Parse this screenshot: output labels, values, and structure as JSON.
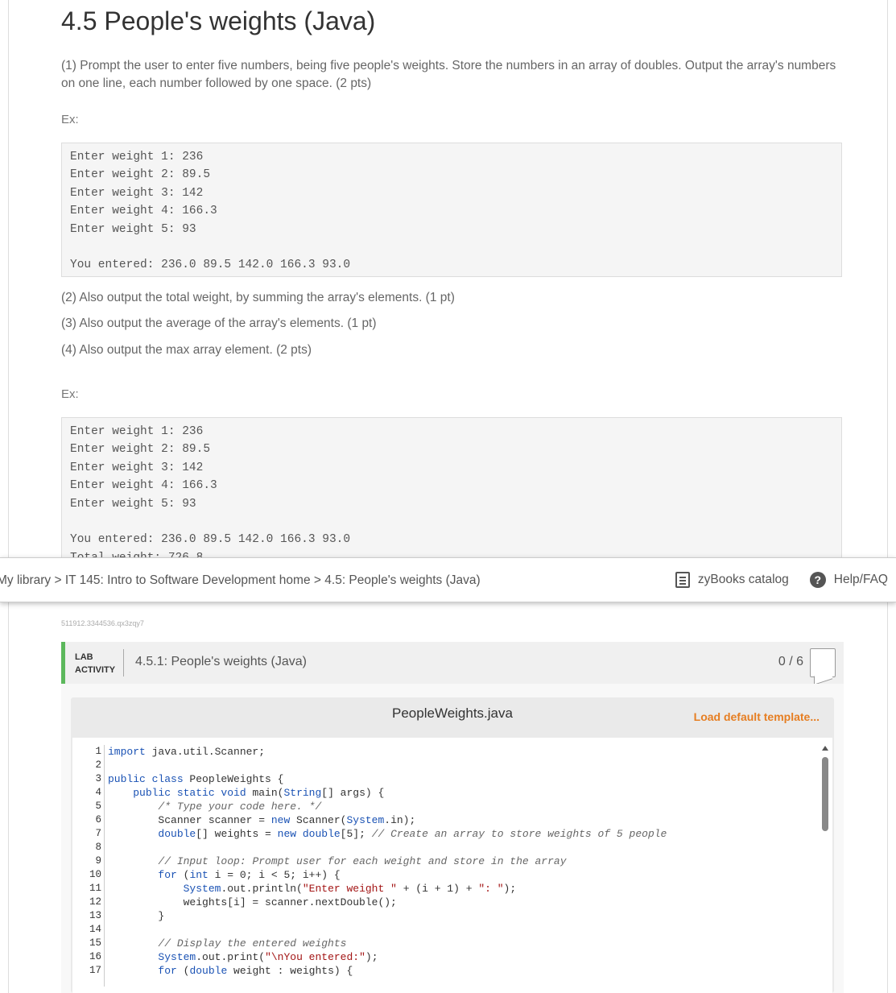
{
  "problem": {
    "title": "4.5 People's weights (Java)",
    "part1": "(1) Prompt the user to enter five numbers, being five people's weights. Store the numbers in an array of doubles. Output the array's numbers on one line, each number followed by one space. (2 pts)",
    "ex_label": "Ex:",
    "example1": {
      "lines": [
        "Enter weight 1: 236",
        "Enter weight 2: 89.5",
        "Enter weight 3: 142",
        "Enter weight 4: 166.3",
        "Enter weight 5: 93"
      ],
      "result": "You entered: 236.0 89.5 142.0 166.3 93.0"
    },
    "part2": "(2) Also output the total weight, by summing the array's elements. (1 pt)",
    "part3": "(3) Also output the average of the array's elements. (1 pt)",
    "part4": "(4) Also output the max array element. (2 pts)",
    "example2": {
      "lines": [
        "Enter weight 1: 236",
        "Enter weight 2: 89.5",
        "Enter weight 3: 142",
        "Enter weight 4: 166.3",
        "Enter weight 5: 93"
      ],
      "result": "You entered: 236.0 89.5 142.0 166.3 93.0",
      "partial": "Total weight: 726.8"
    }
  },
  "navbar": {
    "crumb_library": "My library",
    "sep": ">",
    "crumb_course": "IT 145: Intro to Software Development home",
    "crumb_section": "4.5: People's weights (Java)",
    "catalog": "zyBooks catalog",
    "help": "Help/FAQ",
    "help_glyph": "?"
  },
  "lab": {
    "hash": "511912.3344536.qx3zqy7",
    "tag_line1": "LAB",
    "tag_line2": "ACTIVITY",
    "title": "4.5.1: People's weights (Java)",
    "score": "0 / 6",
    "filename": "PeopleWeights.java",
    "load_template": "Load default template..."
  },
  "code": {
    "line_numbers": [
      "1",
      "2",
      "3",
      "4",
      "5",
      "6",
      "7",
      "8",
      "9",
      "10",
      "11",
      "12",
      "13",
      "14",
      "15",
      "16",
      "17"
    ]
  }
}
